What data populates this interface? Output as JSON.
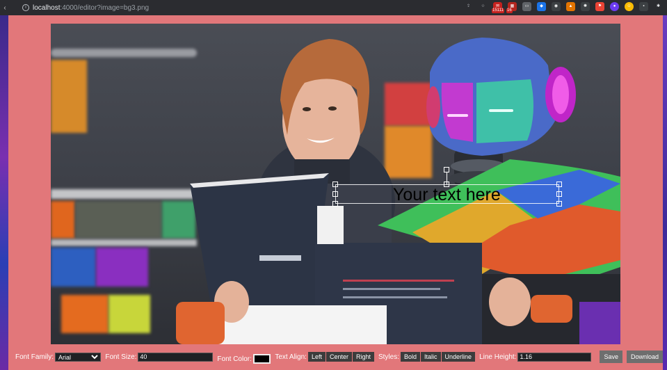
{
  "browser": {
    "back_icon": "‹",
    "url_host": "localhost",
    "url_path": ":4000/editor?image=bg3.png",
    "badges": [
      "15111",
      "16"
    ]
  },
  "editor": {
    "text_content": "Your text here",
    "colors": {
      "page_bg": "#e2777a",
      "font_color": "#000000"
    }
  },
  "toolbar": {
    "font_family_label": "Font Family:",
    "font_family_value": "Arial",
    "font_size_label": "Font Size:",
    "font_size_value": "40",
    "font_color_label": "Font Color:",
    "text_align_label": "Text Align:",
    "align_left": "Left",
    "align_center": "Center",
    "align_right": "Right",
    "styles_label": "Styles:",
    "bold": "Bold",
    "italic": "Italic",
    "underline": "Underline",
    "line_height_label": "Line Height:",
    "line_height_value": "1.16",
    "save": "Save",
    "download": "Download"
  }
}
